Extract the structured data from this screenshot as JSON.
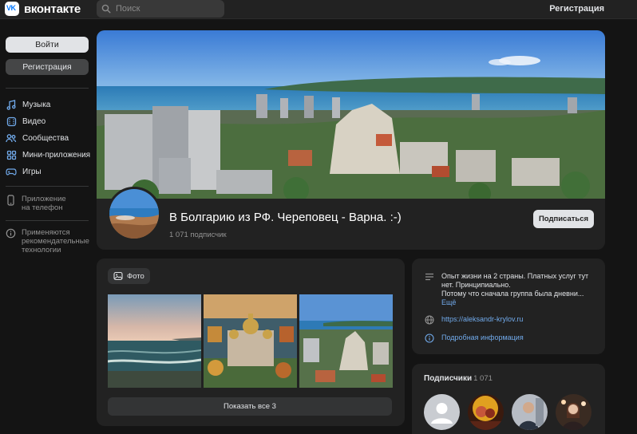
{
  "header": {
    "logo_text": "вконтакте",
    "search_placeholder": "Поиск",
    "register_label": "Регистрация"
  },
  "sidebar": {
    "login_label": "Войти",
    "register_label": "Регистрация",
    "items": [
      {
        "label": "Музыка",
        "icon": "music-icon"
      },
      {
        "label": "Видео",
        "icon": "video-icon"
      },
      {
        "label": "Сообщества",
        "icon": "communities-icon"
      },
      {
        "label": "Мини-приложения",
        "icon": "mini-apps-icon"
      },
      {
        "label": "Игры",
        "icon": "games-icon"
      }
    ],
    "app_line1": "Приложение",
    "app_line2": "на телефон",
    "rec_line1": "Применяются",
    "rec_line2": "рекомендательные",
    "rec_line3": "технологии"
  },
  "group": {
    "title": "В Болгарию из РФ. Череповец - Варна. :-)",
    "subscribers": "1 071 подписчик",
    "subscribe_label": "Подписаться"
  },
  "photos": {
    "chip_label": "Фото",
    "show_all_label": "Показать все 3"
  },
  "info": {
    "desc_line1": "Опыт жизни на 2 страны. Платных услуг тут",
    "desc_line2": "нет. Принципиально.",
    "desc_line3": "Потому что сначала группа была дневни...",
    "more_label": "Ещё",
    "website": "https://aleksandr-krylov.ru",
    "details_label": "Подробная информация"
  },
  "subscribers": {
    "title": "Подписчики",
    "count": "1 071"
  },
  "colors": {
    "background": "#141414",
    "card": "#222222",
    "link": "#71aaeb",
    "accent": "#0077ff"
  }
}
